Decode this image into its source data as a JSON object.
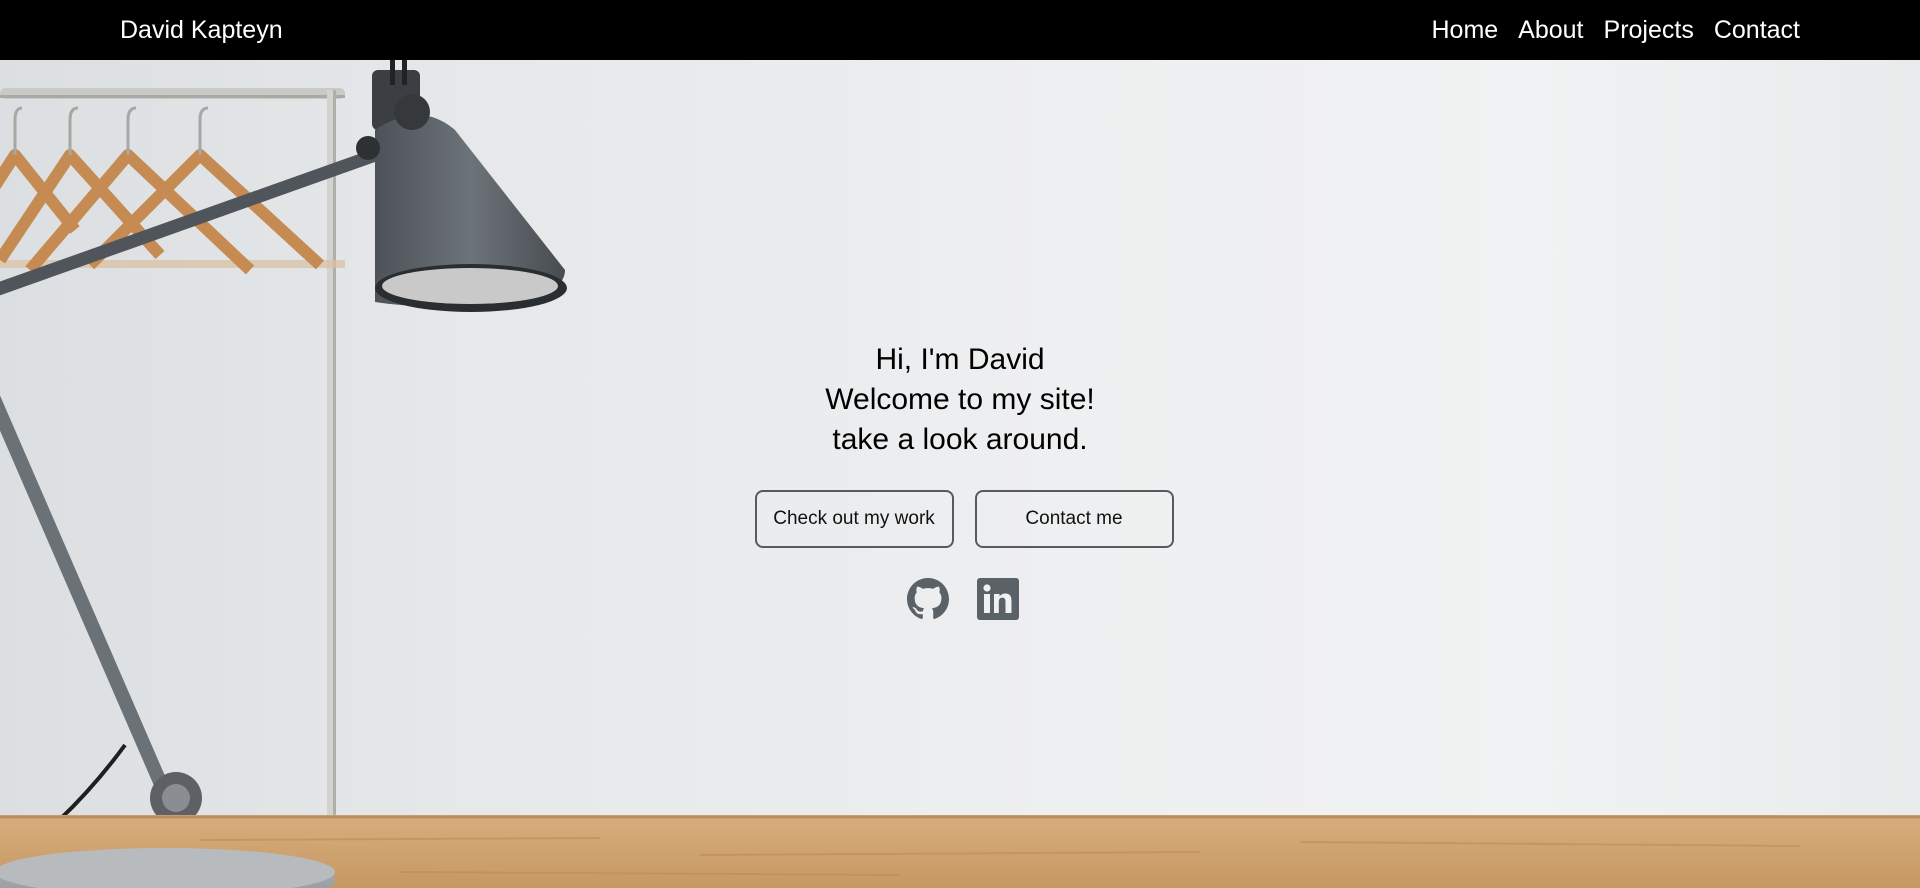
{
  "navbar": {
    "brand": "David Kapteyn",
    "links": [
      "Home",
      "About",
      "Projects",
      "Contact"
    ]
  },
  "hero": {
    "lines": [
      "Hi, I'm David",
      "Welcome to my site!",
      "take a look around."
    ],
    "buttons": {
      "work": "Check out my work",
      "contact": "Contact me"
    },
    "socials": [
      "github-icon",
      "linkedin-icon"
    ]
  },
  "colors": {
    "navbar_bg": "#000000",
    "nav_text": "#ffffff",
    "icon": "#5a6167",
    "button_border": "#555b60"
  }
}
